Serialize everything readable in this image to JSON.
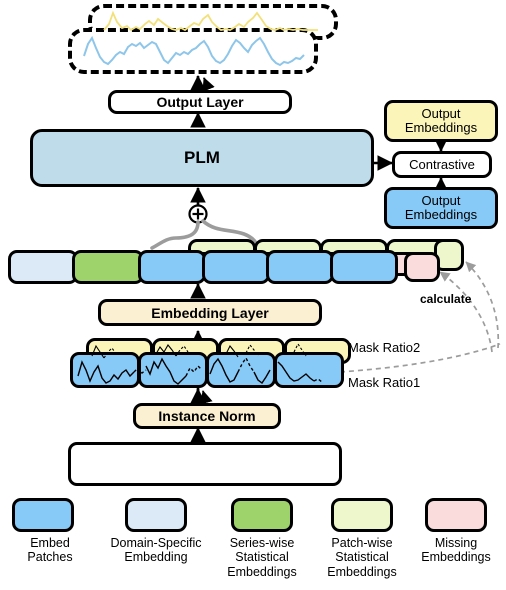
{
  "diagram": {
    "title": "Time-series PLM masked-pretraining architecture",
    "colors": {
      "embed_patches": "#87c9f7",
      "domain_specific": "#dbeaf6",
      "series_wise": "#9ed26a",
      "patch_wise": "#eef7cc",
      "missing": "#fbdcdc",
      "plm": "#bfdceb",
      "layer_cream": "#fbf0d2",
      "mask_yellow": "#fbf5ba",
      "output_emb_yellow": "#fbf5ba",
      "outline": "#000000",
      "dashed_grey": "#9c9c9c"
    }
  },
  "top_output": {
    "yellow_curve_name": "predicted-series-curve",
    "blue_curve_name": "ground-truth-series-curve"
  },
  "blocks": {
    "output_layer": "Output Layer",
    "plm": "PLM",
    "embedding_layer": "Embedding Layer",
    "instance_norm": "Instance Norm",
    "contrastive": "Contrastive",
    "output_embeddings_yellow": "Output\nEmbeddings",
    "output_embeddings_yellow_line1": "Output",
    "output_embeddings_yellow_line2": "Embeddings",
    "output_embeddings_blue_line1": "Output",
    "output_embeddings_blue_line2": "Embeddings",
    "add_symbol": "⊕"
  },
  "annotations": {
    "mask_ratio_2": "Mask Ratio2",
    "mask_ratio_1": "Mask Ratio1",
    "calculate": "calculate"
  },
  "token_rows": {
    "base_row_count": 6,
    "base_row_kinds": [
      "domain-specific",
      "series-wise",
      "embed",
      "embed",
      "embed",
      "embed"
    ],
    "missing_row_count": 5,
    "patchwise_row_count": 5,
    "mask_patch_count": 4
  },
  "legend": {
    "items": [
      {
        "label_line1": "Embed",
        "label_line2": "Patches",
        "label_line3": "",
        "color": "#87c9f7",
        "name": "legend-embed-patches"
      },
      {
        "label_line1": "Domain-Specific",
        "label_line2": "Embedding",
        "label_line3": "",
        "color": "#dbeaf6",
        "name": "legend-domain-specific-embedding"
      },
      {
        "label_line1": "Series-wise",
        "label_line2": "Statistical",
        "label_line3": "Embeddings",
        "color": "#9ed26a",
        "name": "legend-series-wise-statistical-embeddings"
      },
      {
        "label_line1": "Patch-wise",
        "label_line2": "Statistical",
        "label_line3": "Embeddings",
        "color": "#eef7cc",
        "name": "legend-patch-wise-statistical-embeddings"
      },
      {
        "label_line1": "Missing",
        "label_line2": "Embeddings",
        "label_line3": "",
        "color": "#fbdcdc",
        "name": "legend-missing-embeddings"
      }
    ]
  }
}
